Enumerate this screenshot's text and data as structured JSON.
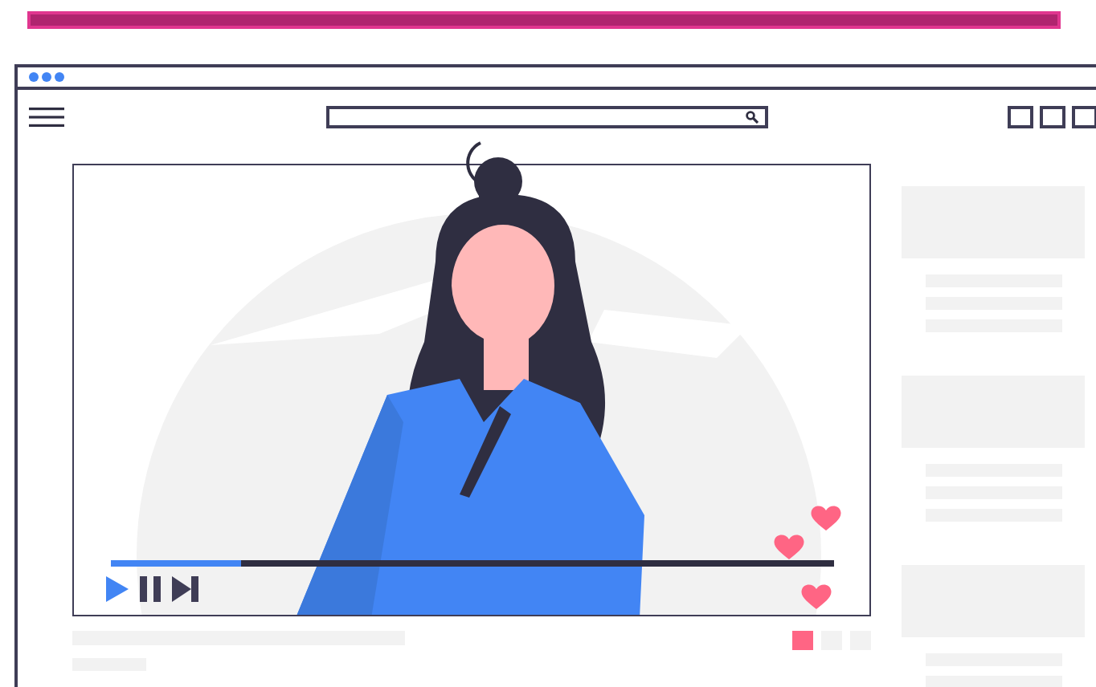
{
  "video": {
    "progress": {
      "level": 0.18
    }
  },
  "pages": [
    {
      "selected": true
    },
    {
      "selected": false
    },
    {
      "selected": false
    }
  ]
}
